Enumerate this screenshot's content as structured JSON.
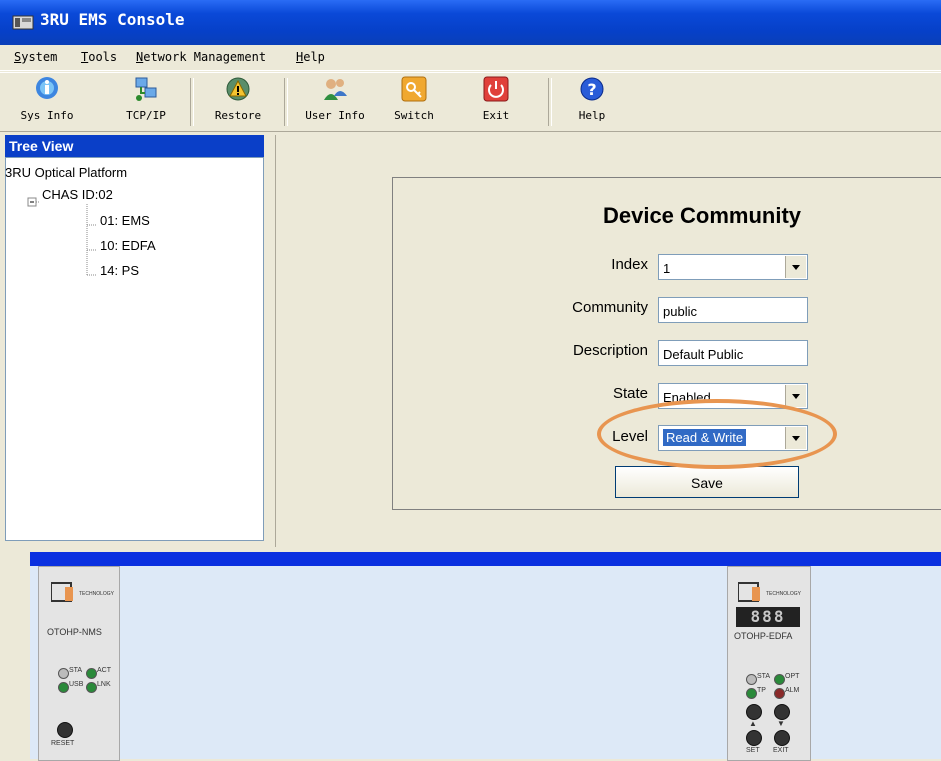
{
  "window": {
    "title": "3RU EMS Console",
    "title_icon": "app-icon"
  },
  "menu": {
    "items": [
      "System",
      "Tools",
      "Network Management",
      "Help"
    ]
  },
  "toolbar": {
    "buttons": [
      {
        "label": "Sys Info",
        "icon": "info-globe-icon"
      },
      {
        "label": "TCP/IP",
        "icon": "network-icon"
      },
      {
        "label": "Restore",
        "icon": "warning-restore-icon"
      },
      {
        "label": "User Info",
        "icon": "users-icon"
      },
      {
        "label": "Switch",
        "icon": "key-icon"
      },
      {
        "label": "Exit",
        "icon": "power-icon"
      },
      {
        "label": "Help",
        "icon": "help-icon"
      }
    ]
  },
  "tree": {
    "header": "Tree View",
    "root": "3RU Optical Platform",
    "chassis": "CHAS ID:02",
    "cards": [
      "01: EMS",
      "10: EDFA",
      "14: PS"
    ]
  },
  "form": {
    "title": "Device Community",
    "index_label": "Index",
    "index_value": "1",
    "community_label": "Community",
    "community_value": "public",
    "description_label": "Description",
    "description_value": "Default Public",
    "state_label": "State",
    "state_value": "Enabled",
    "level_label": "Level",
    "level_value": "Read & Write",
    "save_label": "Save"
  },
  "modules": {
    "nms": {
      "logo": "TECHNOLOGY",
      "name": "OTOHP-NMS",
      "led_labels": [
        "STA",
        "ACT",
        "USB",
        "LNK"
      ],
      "reset_label": "RESET"
    },
    "edfa": {
      "logo": "TECHNOLOGY",
      "display": "888",
      "name": "OTOHP-EDFA",
      "led_labels": [
        "STA",
        "OPT",
        "TP",
        "ALM"
      ],
      "set_label": "SET",
      "exit_label": "EXIT"
    }
  },
  "colors": {
    "titlebar": "#0a49d8",
    "tree_header": "#0a3fc8",
    "highlight": "#e89550",
    "selection": "#316ac5"
  }
}
